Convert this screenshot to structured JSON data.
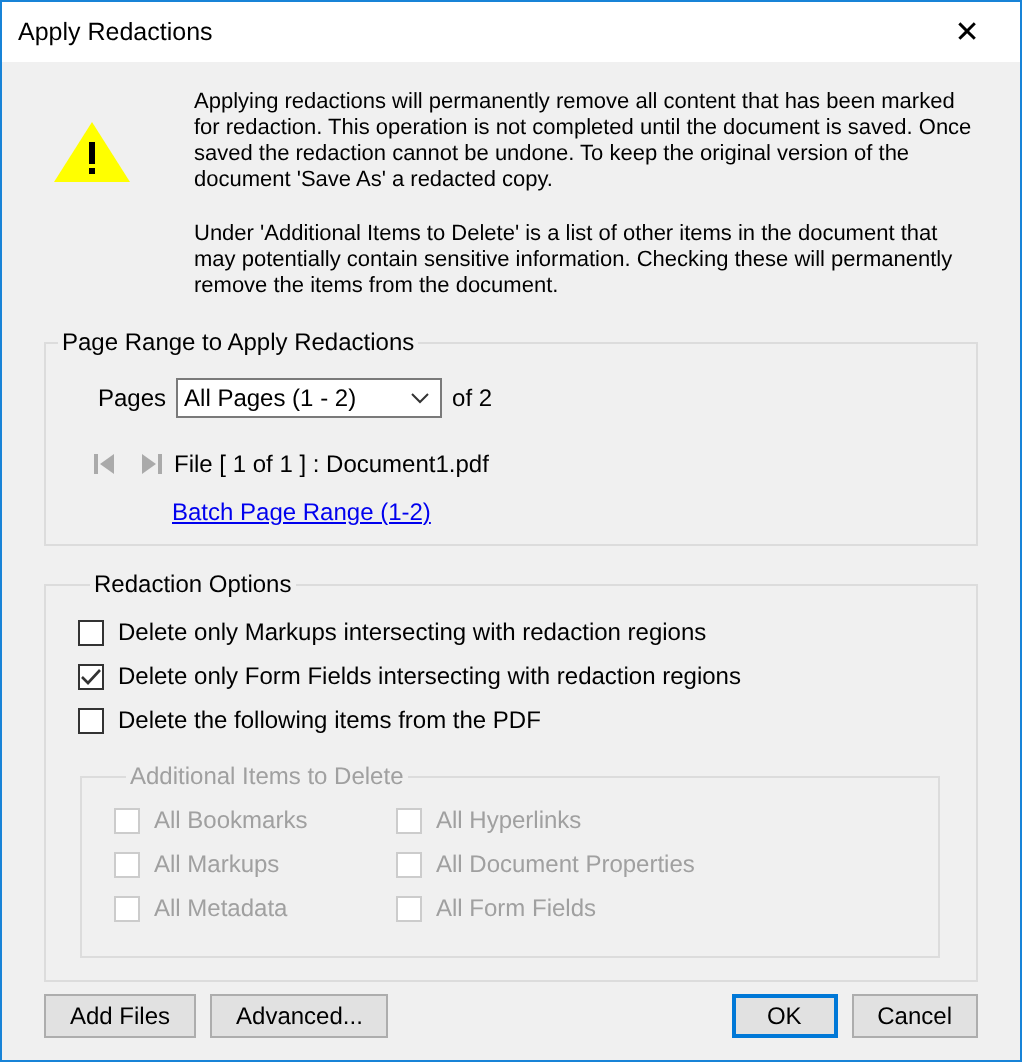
{
  "window": {
    "title": "Apply Redactions",
    "close": "✕"
  },
  "message": {
    "paragraphs": [
      "Applying redactions will permanently remove all content that has been marked for redaction. This operation is not completed until the document is saved. Once saved the redaction cannot be undone. To keep the original version of the document 'Save As' a redacted copy.",
      "Under 'Additional Items to Delete' is a list of other items in the document that may potentially contain sensitive information. Checking these will permanently remove the items from the document."
    ]
  },
  "page_range": {
    "title": "Page Range to Apply Redactions",
    "pages_label": "Pages",
    "pages_value": "All Pages (1 - 2)",
    "of_total": "of 2",
    "file_info": "File [ 1 of 1 ] :  Document1.pdf",
    "batch_link": "Batch Page Range (1-2)"
  },
  "redaction_options": {
    "title": "Redaction Options",
    "options": [
      {
        "label": "Delete only Markups intersecting with redaction regions",
        "checked": false
      },
      {
        "label": "Delete only Form Fields intersecting with redaction regions",
        "checked": true
      },
      {
        "label": "Delete the following items from the PDF",
        "checked": false
      }
    ],
    "additional": {
      "title": "Additional Items to Delete",
      "disabled": true,
      "items": [
        {
          "label": "All Bookmarks",
          "checked": false
        },
        {
          "label": "All Markups",
          "checked": false
        },
        {
          "label": "All Metadata",
          "checked": false
        },
        {
          "label": "All Hyperlinks",
          "checked": false
        },
        {
          "label": "All Document Properties",
          "checked": false
        },
        {
          "label": "All Form Fields",
          "checked": false
        }
      ]
    }
  },
  "buttons": [
    {
      "label": "Add Files",
      "default": false
    },
    {
      "label": "Advanced...",
      "default": false
    },
    {
      "label": "OK",
      "default": true
    },
    {
      "label": "Cancel",
      "default": false
    }
  ]
}
